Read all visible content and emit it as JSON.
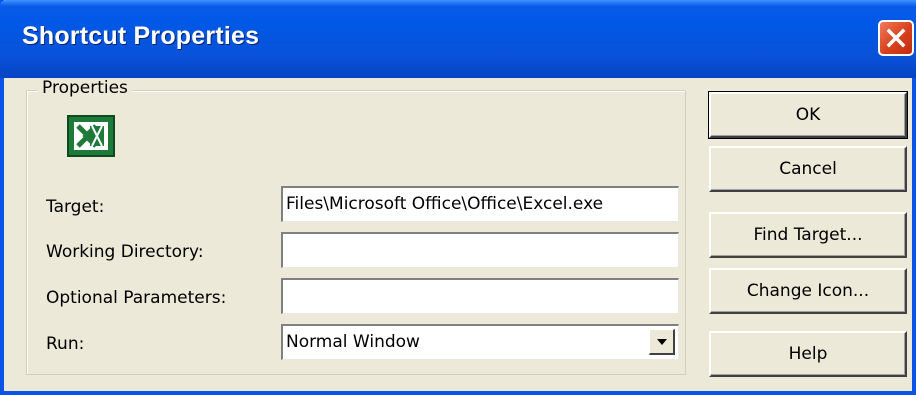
{
  "window": {
    "title": "Shortcut Properties",
    "accent_color": "#0058e6",
    "close_color": "#d8401c"
  },
  "properties_group": {
    "legend": "Properties",
    "icon": "excel-icon"
  },
  "fields": {
    "target": {
      "label": "Target:",
      "value": "Files\\Microsoft Office\\Office\\Excel.exe"
    },
    "working_directory": {
      "label": "Working Directory:",
      "value": ""
    },
    "optional_parameters": {
      "label": "Optional Parameters:",
      "value": ""
    },
    "run": {
      "label": "Run:",
      "value": "Normal Window"
    }
  },
  "buttons": {
    "ok": "OK",
    "cancel": "Cancel",
    "find_target": "Find Target...",
    "change_icon": "Change Icon...",
    "help": "Help"
  }
}
